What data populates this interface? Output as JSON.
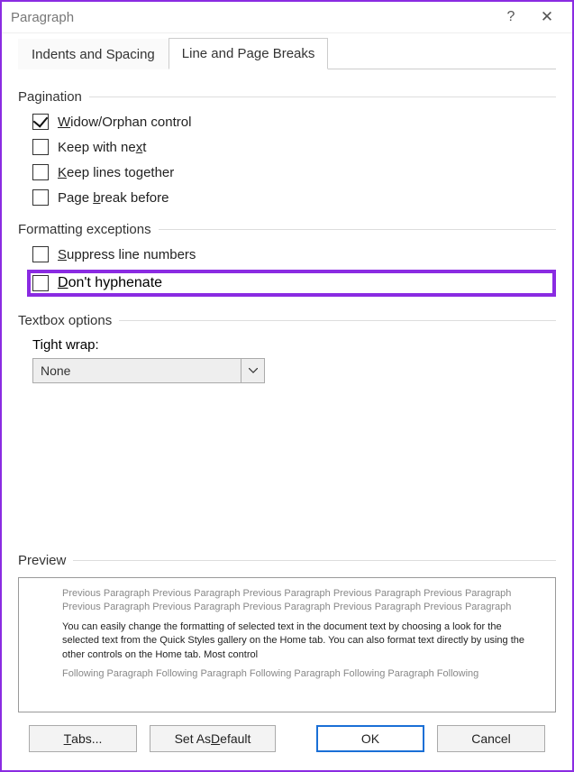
{
  "title": "Paragraph",
  "tabs": {
    "indents": "Indents and Spacing",
    "linebreaks": "Line and Page Breaks"
  },
  "pagination": {
    "label": "Pagination",
    "widow": {
      "pre": "",
      "u": "W",
      "post": "idow/Orphan control",
      "checked": true
    },
    "keepnext": {
      "pre": "Keep with ne",
      "u": "x",
      "post": "t",
      "checked": false
    },
    "keeptogether": {
      "pre": "",
      "u": "K",
      "post": "eep lines together",
      "checked": false
    },
    "pagebreak": {
      "pre": "Page ",
      "u": "b",
      "post": "reak before",
      "checked": false
    }
  },
  "formatting": {
    "label": "Formatting exceptions",
    "suppress": {
      "pre": "",
      "u": "S",
      "post": "uppress line numbers",
      "checked": false
    },
    "donthyphen": {
      "pre": "",
      "u": "D",
      "post": "on't hyphenate",
      "checked": false
    }
  },
  "textbox": {
    "label": "Textbox options",
    "tightwrap_label": "Tight wrap:",
    "tightwrap_value": "None"
  },
  "preview": {
    "label": "Preview",
    "prev": "Previous Paragraph Previous Paragraph Previous Paragraph Previous Paragraph Previous Paragraph Previous Paragraph Previous Paragraph Previous Paragraph Previous Paragraph Previous Paragraph",
    "current": "You can easily change the formatting of selected text in the document text by choosing a look for the selected text from the Quick Styles gallery on the Home tab. You can also format text directly by using the other controls on the Home tab. Most control",
    "next": "Following Paragraph Following Paragraph Following Paragraph Following Paragraph Following"
  },
  "buttons": {
    "tabs": {
      "pre": "",
      "u": "T",
      "post": "abs..."
    },
    "default": {
      "pre": "Set As ",
      "u": "D",
      "post": "efault"
    },
    "ok": "OK",
    "cancel": "Cancel"
  }
}
